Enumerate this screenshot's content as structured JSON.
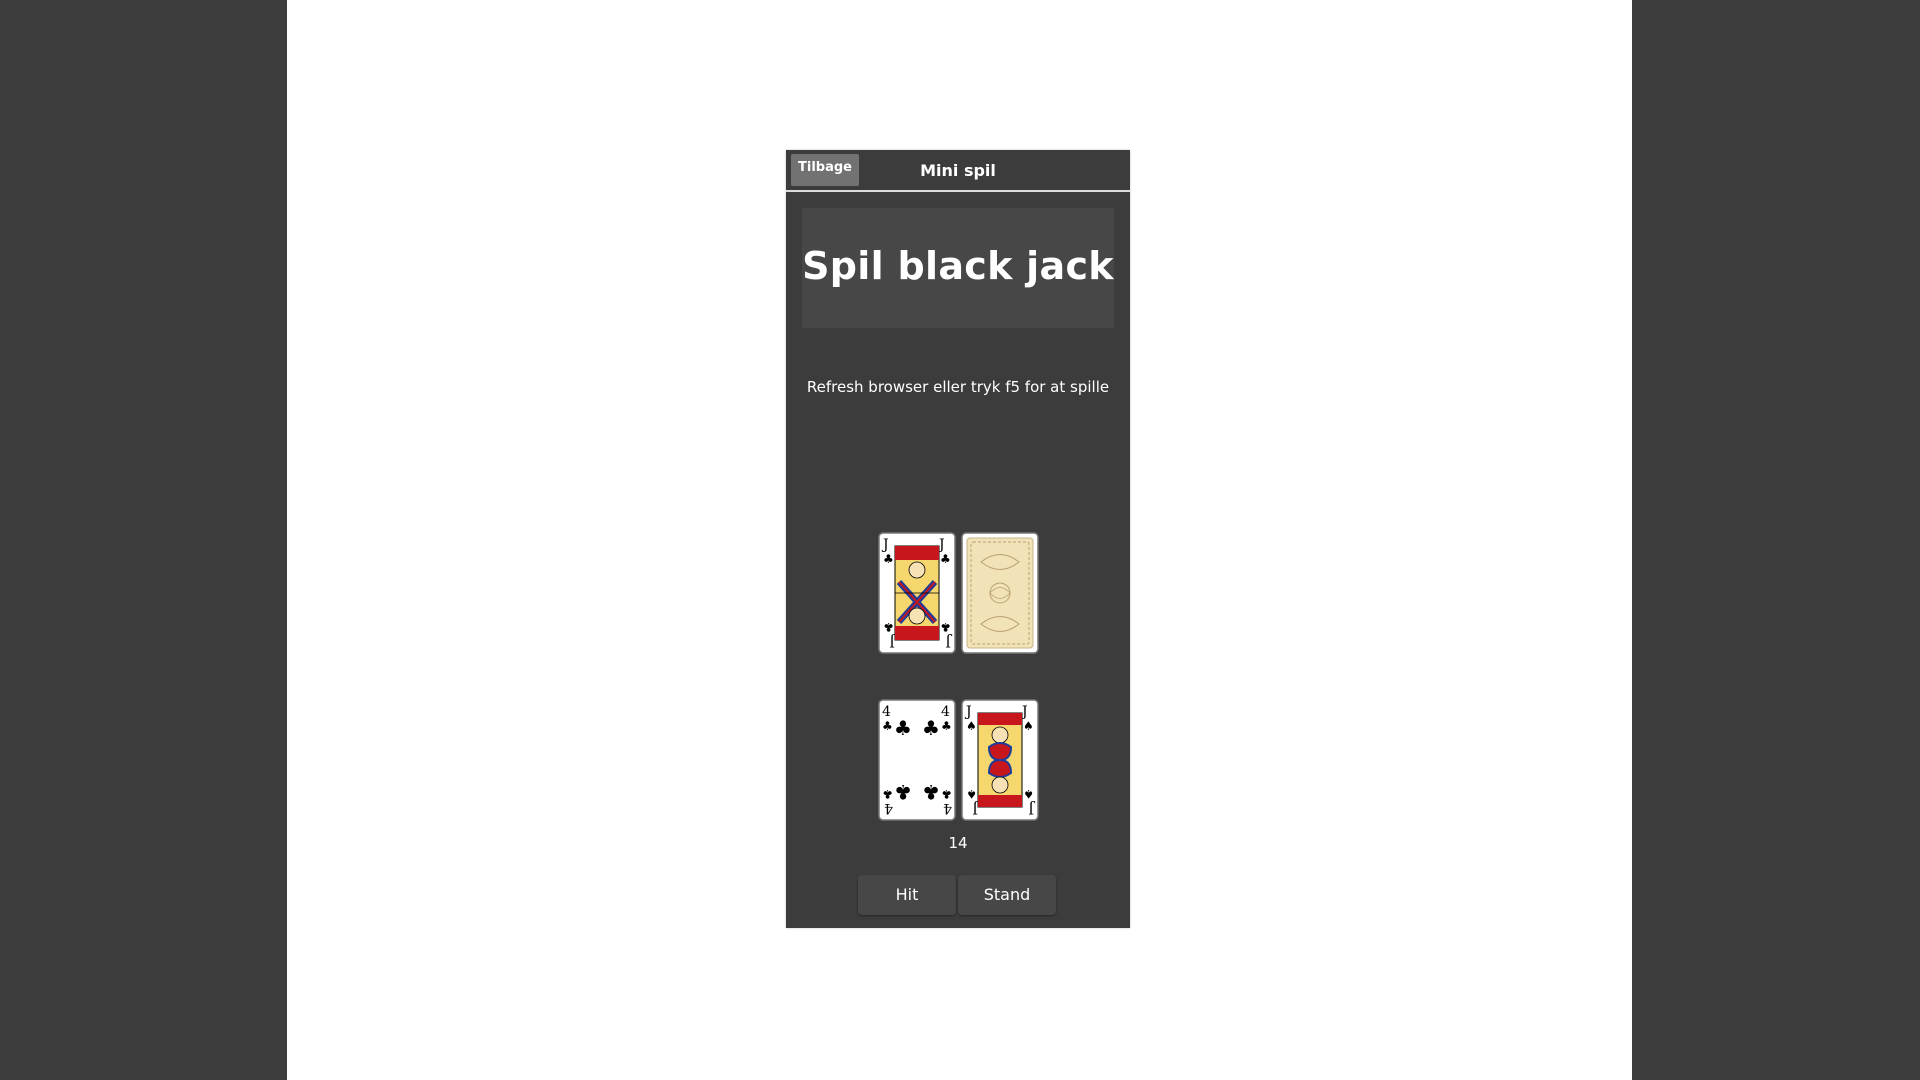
{
  "topbar": {
    "back_label": "Tilbage",
    "title": "Mini spil"
  },
  "header": {
    "title": "Spil black jack"
  },
  "info_text": "Refresh browser eller tryk f5 for at spille",
  "dealer": {
    "cards": [
      {
        "rank": "J",
        "suit": "♣",
        "face": "jack-of-clubs",
        "face_down": false
      },
      {
        "face": "card-back",
        "face_down": true
      }
    ]
  },
  "player": {
    "cards": [
      {
        "rank": "4",
        "suit": "♣",
        "face": "four-of-clubs",
        "face_down": false
      },
      {
        "rank": "J",
        "suit": "♠",
        "face": "jack-of-spades",
        "face_down": false
      }
    ],
    "score": "14"
  },
  "actions": {
    "hit_label": "Hit",
    "stand_label": "Stand"
  },
  "colors": {
    "panel": "#3c3c3c",
    "header_box": "#474747",
    "back_button": "#727272"
  }
}
